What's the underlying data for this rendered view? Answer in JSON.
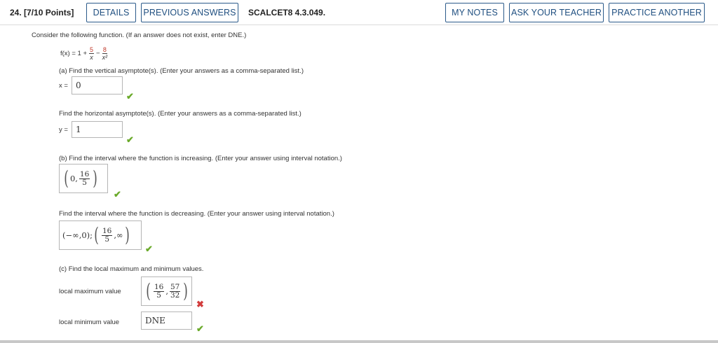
{
  "header": {
    "question_number": "24.",
    "points": "[7/10 Points]",
    "details_label": "DETAILS",
    "previous_answers_label": "PREVIOUS ANSWERS",
    "problem_code": "SCALCET8 4.3.049.",
    "my_notes_label": "MY NOTES",
    "ask_teacher_label": "ASK YOUR TEACHER",
    "practice_another_label": "PRACTICE ANOTHER"
  },
  "prompt": "Consider the following function. (If an answer does not exist, enter DNE.)",
  "function": {
    "lhs": "f(x) = 1 +",
    "term1_num": "5",
    "term1_den": "x",
    "minus": "−",
    "term2_num": "8",
    "term2_den": "x²"
  },
  "part_a": {
    "question": "(a) Find the vertical asymptote(s). (Enter your answers as a comma-separated list.)",
    "var_label": "x =",
    "answer": "0",
    "status": "correct",
    "question2": "Find the horizontal asymptote(s). (Enter your answers as a comma-separated list.)",
    "var_label2": "y =",
    "answer2": "1",
    "status2": "correct"
  },
  "part_b": {
    "question": "(b) Find the interval where the function is increasing. (Enter your answer using interval notation.)",
    "increasing": {
      "left": "0,",
      "num": "16",
      "den": "5"
    },
    "status": "correct",
    "question2": "Find the interval where the function is decreasing. (Enter your answer using interval notation.)",
    "decreasing": {
      "first": "(−∞,0);",
      "num": "16",
      "den": "5",
      "tail": ",∞"
    },
    "status2": "correct"
  },
  "part_c": {
    "question": "(c) Find the local maximum and minimum values.",
    "max_label": "local maximum value",
    "max_answer": {
      "x_num": "16",
      "x_den": "5",
      "y_num": "57",
      "y_den": "32"
    },
    "max_status": "incorrect",
    "min_label": "local minimum value",
    "min_answer": "DNE",
    "min_status": "correct"
  },
  "icons": {
    "correct": "checkmark-icon",
    "incorrect": "x-mark-icon"
  },
  "colors": {
    "accent": "#1f4f80",
    "correct": "#6aaa2a",
    "incorrect": "#d23c3c",
    "fraction_num": "#c0392b"
  }
}
